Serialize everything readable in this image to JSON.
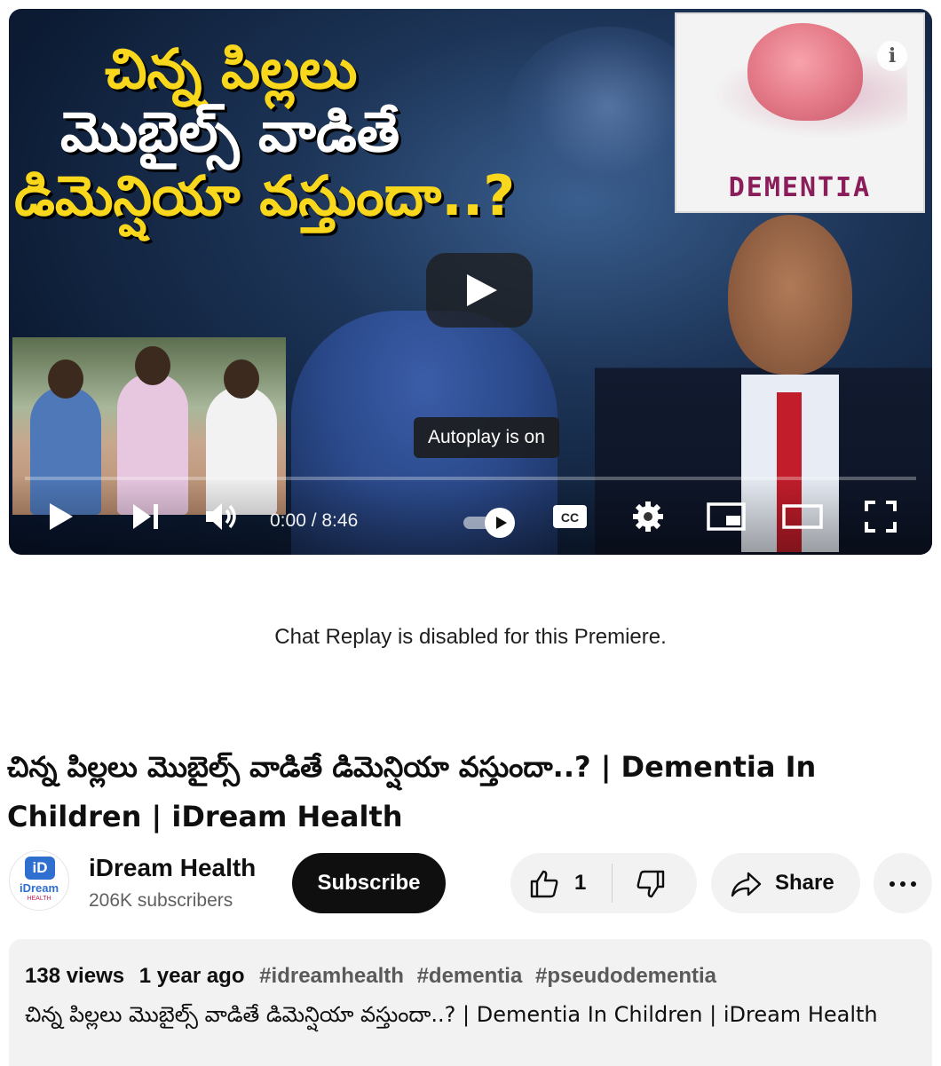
{
  "player": {
    "thumbnail": {
      "title_lines": [
        "చిన్న పిల్లలు",
        "మొబైల్స్ వాడితే",
        "డిమెన్షియా వస్తుందా..?"
      ],
      "card_word": "DEMENTIA",
      "info_glyph": "i"
    },
    "tooltip": "Autoplay is on",
    "time": "0:00 / 8:46",
    "controls": {
      "play_icon": "play-icon",
      "next_icon": "next-icon",
      "volume_icon": "volume-icon",
      "autoplay_icon": "autoplay-toggle",
      "cc_label": "CC",
      "settings_icon": "gear-icon",
      "miniplayer_icon": "miniplayer-icon",
      "theater_icon": "theater-icon",
      "fullscreen_icon": "fullscreen-icon"
    }
  },
  "chat_replay": "Chat Replay is disabled for this Premiere.",
  "video": {
    "title": "చిన్న పిల్లలు మొబైల్స్ వాడితే డిమెన్షియా వస్తుందా..? | Dementia In Children | iDream Health"
  },
  "channel": {
    "avatar_box": "iD",
    "avatar_text": "iDream",
    "avatar_sub": "HEALTH",
    "name": "iDream Health",
    "subscribers": "206K subscribers"
  },
  "actions": {
    "subscribe": "Subscribe",
    "likes": "1",
    "share": "Share"
  },
  "description": {
    "views": "138 views",
    "age": "1 year ago",
    "hashtags": [
      "#idreamhealth",
      "#dementia",
      "#pseudodementia"
    ],
    "text": "చిన్న పిల్లలు మొబైల్స్ వాడితే డిమెన్షియా వస్తుందా..? | Dementia In Children | iDream Health"
  },
  "colors": {
    "thumb_yellow": "#f9d71c",
    "dementia_magenta": "#8a1d5a",
    "button_dark": "#0f0f0f",
    "chip_bg": "#f2f2f2"
  }
}
